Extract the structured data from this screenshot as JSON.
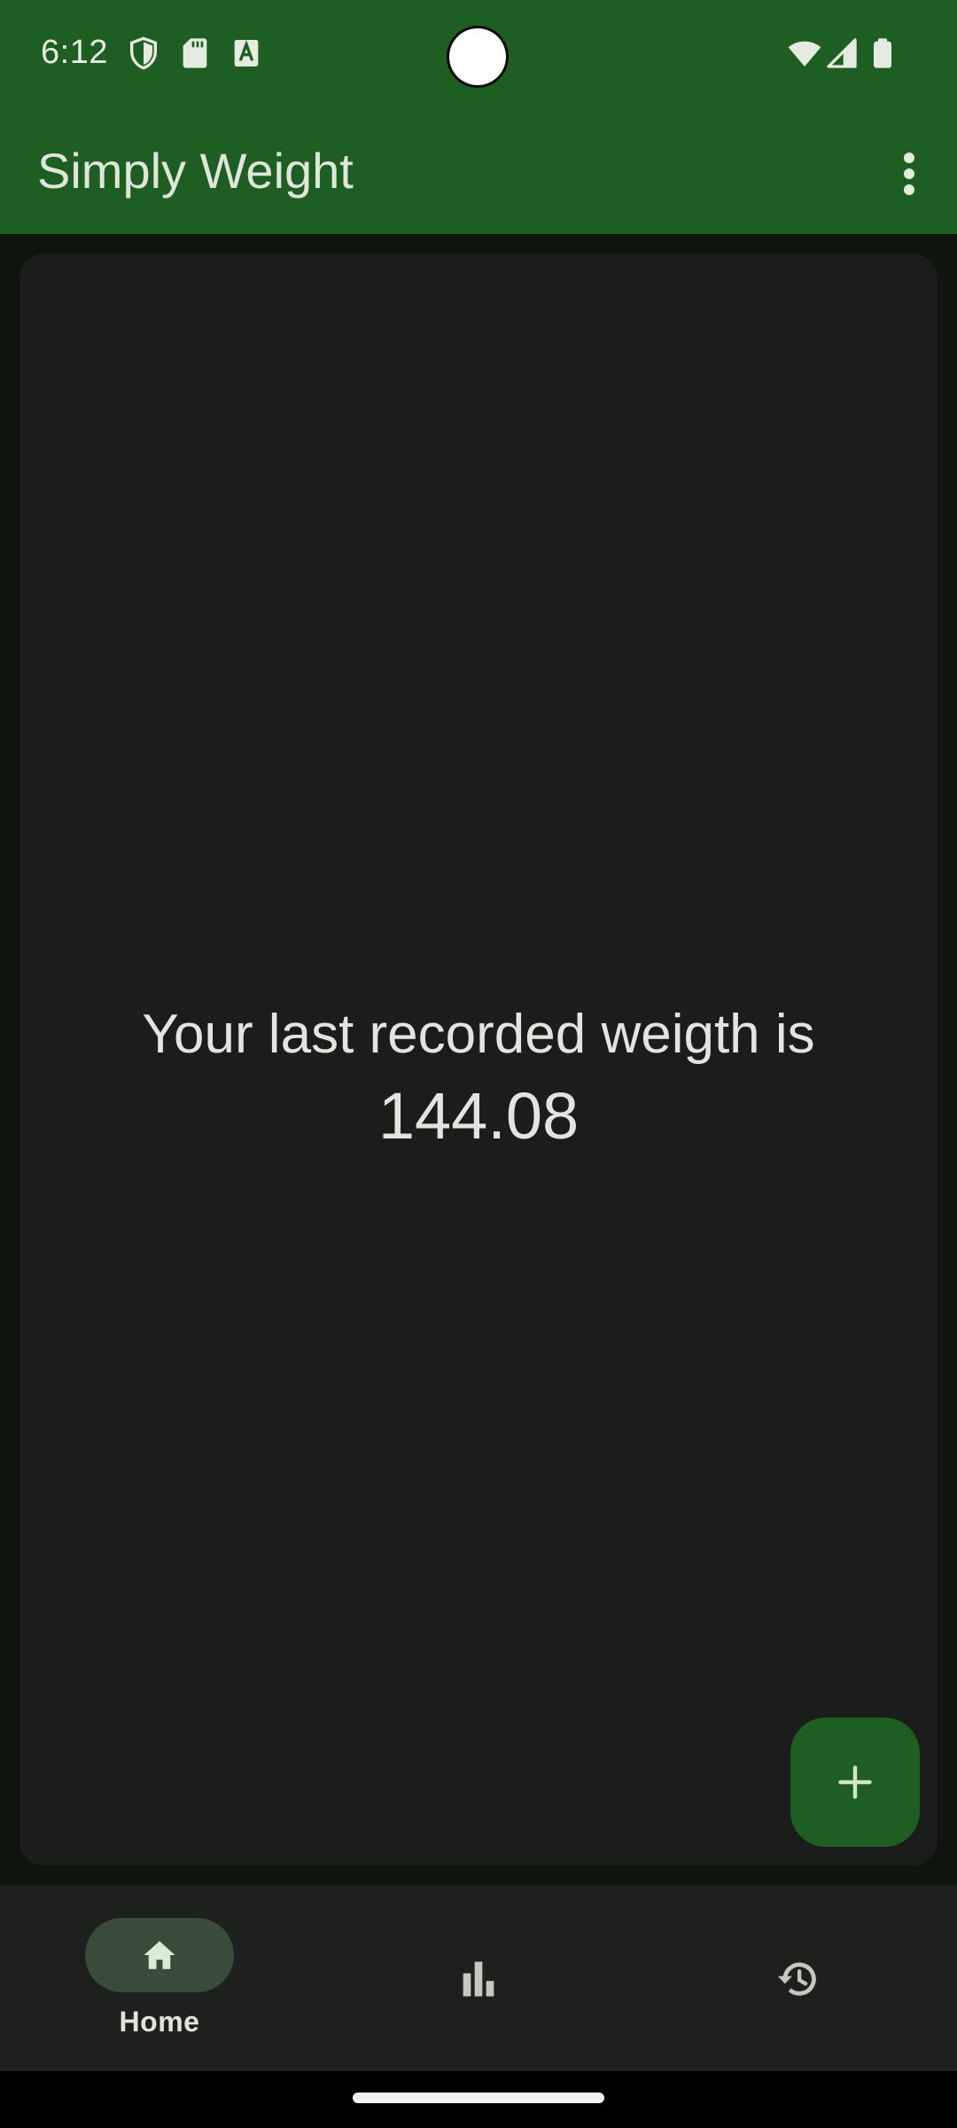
{
  "status_bar": {
    "time": "6:12",
    "icons_left": [
      "shield-icon",
      "sd-card-icon",
      "font-a-icon"
    ],
    "icons_right": [
      "wifi-icon",
      "signal-icon",
      "battery-icon"
    ]
  },
  "app_bar": {
    "title": "Simply Weight",
    "menu_icon": "more-vert-icon"
  },
  "main": {
    "message": "Your last recorded weigth is",
    "weight": "144.08"
  },
  "fab": {
    "icon": "add-icon"
  },
  "bottom_nav": {
    "items": [
      {
        "label": "Home",
        "icon": "home-icon",
        "selected": true
      },
      {
        "label": "",
        "icon": "bar-chart-icon",
        "selected": false
      },
      {
        "label": "",
        "icon": "history-icon",
        "selected": false
      }
    ]
  },
  "colors": {
    "primary": "#1e5e22",
    "background": "#0f140f",
    "card": "#1a1d1a",
    "nav_background": "#1e201d",
    "nav_indicator": "#3a4b39",
    "on_surface": "#e2e5df"
  }
}
